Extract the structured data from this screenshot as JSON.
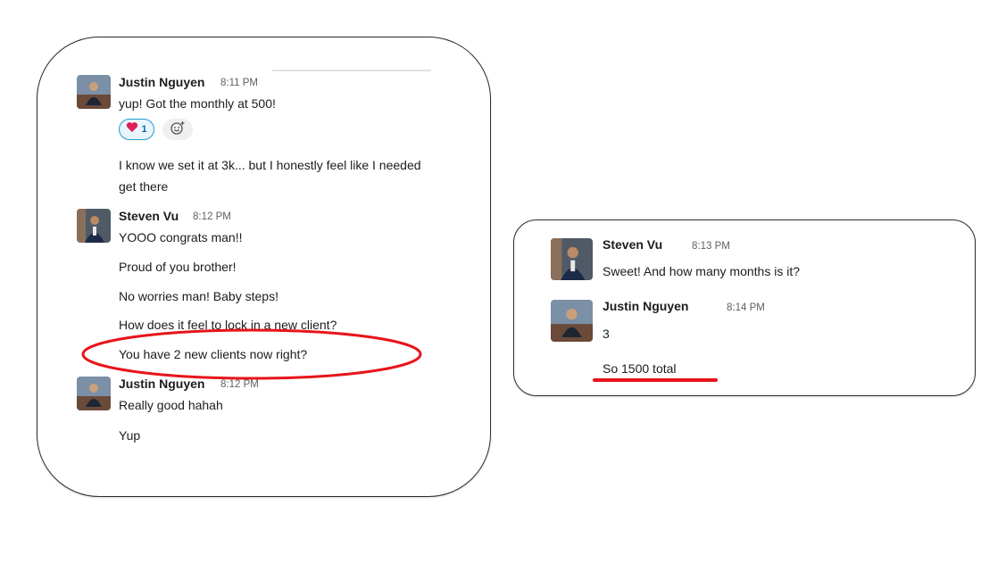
{
  "left_panel": {
    "messages": [
      {
        "author": "Justin Nguyen",
        "time": "8:11 PM",
        "text": "yup! Got the monthly at 500!"
      },
      {
        "text_line1": "I know we set it at 3k... but I honestly feel like I needed",
        "text_line2": "get there"
      },
      {
        "author": "Steven Vu",
        "time": "8:12 PM",
        "text": "YOOO congrats man!!"
      },
      {
        "text": "Proud of you brother!"
      },
      {
        "text": "No worries man! Baby steps!"
      },
      {
        "text": "How does it feel to lock in a new client?"
      },
      {
        "text": "You have 2 new clients now right?"
      },
      {
        "author": "Justin Nguyen",
        "time": "8:12 PM",
        "text": "Really good hahah"
      },
      {
        "text": "Yup"
      }
    ],
    "reaction": {
      "emoji": "heart",
      "count": "1"
    },
    "add_reaction_icon": "add-emoji-icon"
  },
  "right_panel": {
    "messages": [
      {
        "author": "Steven Vu",
        "time": "8:13 PM",
        "text": "Sweet! And how many months is it?"
      },
      {
        "author": "Justin Nguyen",
        "time": "8:14 PM",
        "text": "3"
      },
      {
        "text": "So 1500 total"
      }
    ]
  },
  "colors": {
    "annotation_red": "#e8141a",
    "reaction_border": "#1d9bd1",
    "reaction_bg": "#e8f5fa",
    "heart": "#e01e5a"
  }
}
